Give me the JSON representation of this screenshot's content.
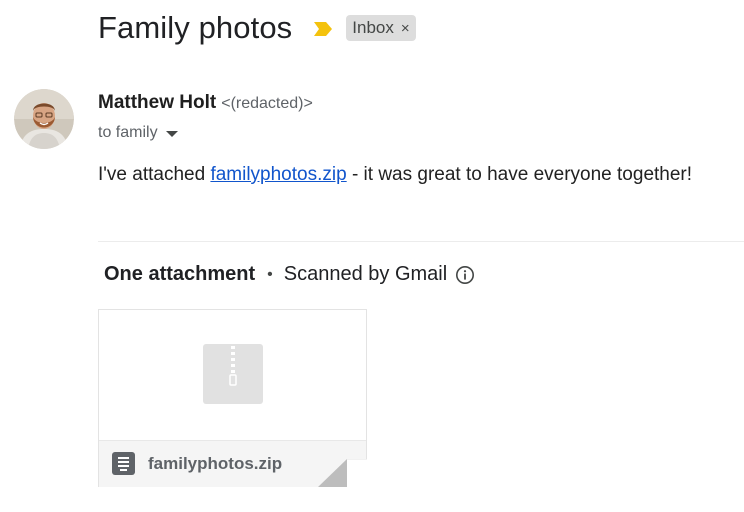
{
  "subject": {
    "title": "Family photos",
    "importance_icon": "importance-marker-icon",
    "importance_color": "#f4c20d",
    "label": "Inbox",
    "label_close": "×"
  },
  "sender": {
    "name": "Matthew Holt",
    "email": "<(redacted)>",
    "avatar": "avatar-photo",
    "recipients": "to family",
    "recipients_icon": "caret-down-icon"
  },
  "body": {
    "prefix": "I've attached ",
    "link_text": "familyphotos.zip",
    "suffix": " - it was great to have everyone together!",
    "link_color": "#1155cc"
  },
  "attachments": {
    "count_label": "One attachment",
    "separator": "•",
    "scan_label": "Scanned by Gmail",
    "info_icon": "info-icon",
    "items": [
      {
        "file_name": "familyphotos.zip",
        "preview_icon": "zip-file-icon",
        "type_icon": "archive-file-icon"
      }
    ]
  }
}
